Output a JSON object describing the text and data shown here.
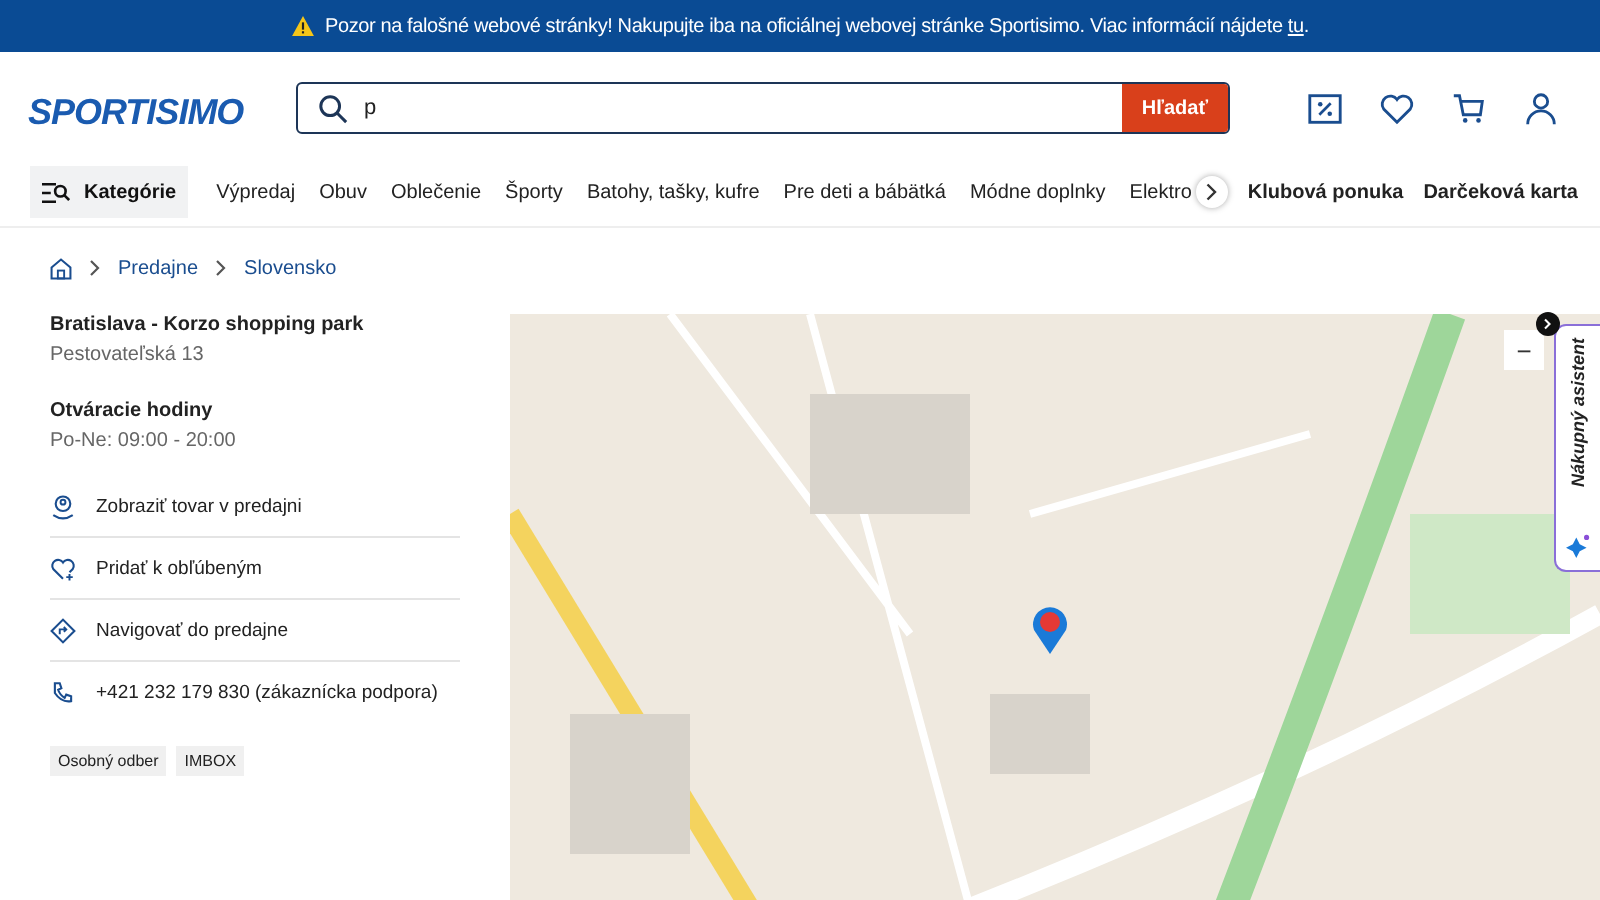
{
  "banner": {
    "text": "Pozor na falošné webové stránky! Nakupujte iba na oficiálnej webovej stránke Sportisimo. Viac informácií nájdete ",
    "link": "tu",
    "end": "."
  },
  "header": {
    "logo": "SPORTISIMO",
    "search": {
      "value": "p",
      "button": "Hľadať"
    }
  },
  "nav": {
    "categories": "Kategórie",
    "items": [
      "Výpredaj",
      "Obuv",
      "Oblečenie",
      "Športy",
      "Batohy, tašky, kufre",
      "Pre deti a bábätká",
      "Módne doplnky",
      "Elektro"
    ],
    "extra": [
      "Klubová ponuka",
      "Darčeková karta"
    ]
  },
  "breadcrumbs": [
    "Predajne",
    "Slovensko"
  ],
  "store": {
    "name": "Bratislava - Korzo shopping park",
    "address": "Pestovateľská 13",
    "hours_title": "Otváracie hodiny",
    "hours": "Po-Ne: 09:00 - 20:00",
    "actions": [
      {
        "kind": "store",
        "label": "Zobraziť tovar v predajni"
      },
      {
        "kind": "favorite",
        "label": "Pridať k obľúbeným"
      },
      {
        "kind": "navigate",
        "label": "Navigovať do predajne"
      },
      {
        "kind": "phone",
        "label": "+421 232 179 830 (zákaznícka podpora)"
      }
    ],
    "tags": [
      "Osobný odber",
      "IMBOX"
    ]
  },
  "map": {
    "zoom_out": "−"
  },
  "assistant": {
    "label": "Nákupný asistent"
  }
}
